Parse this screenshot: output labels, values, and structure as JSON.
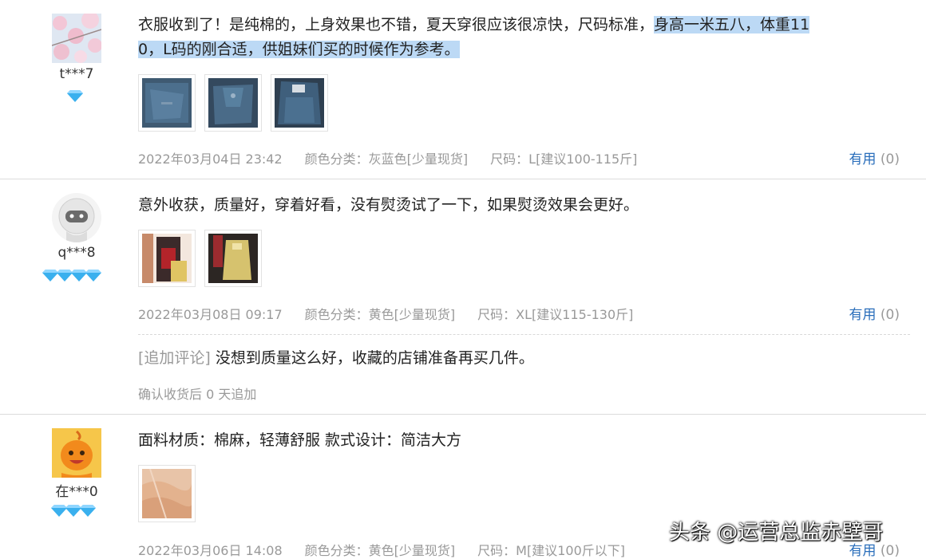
{
  "reviews": [
    {
      "user": "t***7",
      "level": 1,
      "avatar": "cherry-blossom-photo",
      "text_plain": "衣服收到了！是纯棉的，上身效果也不错，夏天穿很应该很凉快，尺码标准，",
      "text_highlight_1": "身高一米五八，体重11",
      "text_highlight_2": "0，L码的刚合适，供姐妹们买的时候作为参考。",
      "date": "2022年03月04日 23:42",
      "color_label": "颜色分类：",
      "color_value": "灰蓝色[少量现货]",
      "size_label": "尺码：",
      "size_value": "L[建议100-115斤]",
      "useful_label": "有用",
      "useful_count": "(0)",
      "photos": 3
    },
    {
      "user": "q***8",
      "level": 4,
      "avatar": "default-astronaut-avatar",
      "text_plain": "意外收获，质量好，穿着好看，没有熨烫试了一下，如果熨烫效果会更好。",
      "date": "2022年03月08日 09:17",
      "color_label": "颜色分类：",
      "color_value": "黄色[少量现货]",
      "size_label": "尺码：",
      "size_value": "XL[建议115-130斤]",
      "useful_label": "有用",
      "useful_count": "(0)",
      "photos": 2,
      "followup_tag": "[追加评论]",
      "followup_text": "没想到质量这么好，收藏的店铺准备再买几件。",
      "followup_note": "确认收货后 0 天追加"
    },
    {
      "user": "在***0",
      "level": 3,
      "avatar": "orange-cartoon-avatar",
      "text_plain": "面料材质：棉麻，轻薄舒服 款式设计：简洁大方",
      "date": "2022年03月06日 14:08",
      "color_label": "颜色分类：",
      "color_value": "黄色[少量现货]",
      "size_label": "尺码：",
      "size_value": "M[建议100斤以下]",
      "useful_label": "有用",
      "useful_count": "(0)",
      "photos": 1
    }
  ],
  "watermark": "头条 @运营总监赤壁哥",
  "colors": {
    "useful_link": "#2a6ebb",
    "highlight": "#bcd9f5",
    "gem": "#3ab0ee",
    "meta": "#999999"
  }
}
